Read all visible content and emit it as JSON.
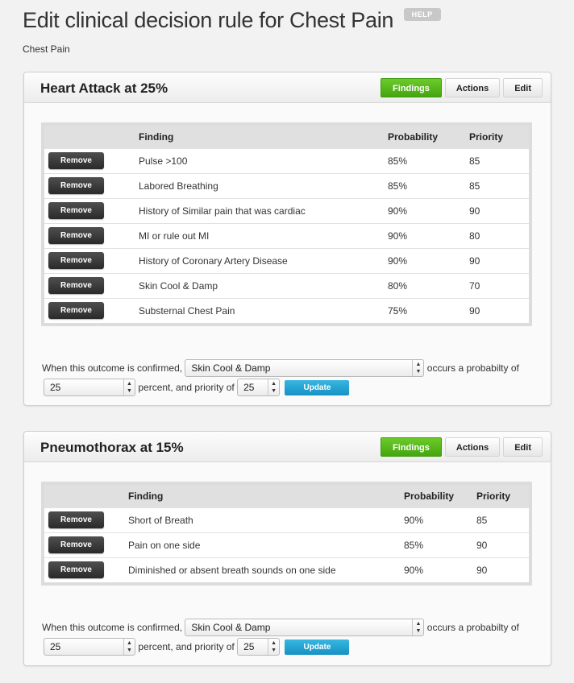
{
  "page": {
    "title": "Edit clinical decision rule for Chest Pain",
    "help_label": "HELP",
    "subtitle": "Chest Pain"
  },
  "tabs": {
    "findings": "Findings",
    "actions": "Actions",
    "edit": "Edit"
  },
  "columns": {
    "finding": "Finding",
    "probability": "Probability",
    "priority": "Priority"
  },
  "remove_label": "Remove",
  "form": {
    "text_confirmed": "When this outcome is confirmed,",
    "text_occurs": "occurs a probabilty of",
    "text_percent": "percent, and priority of",
    "update_label": "Update"
  },
  "colors": {
    "findings_tab": "#56b81a",
    "update_button": "#1fa3d3",
    "remove_button": "#333333"
  },
  "outcomes": [
    {
      "title": "Heart Attack at 25%",
      "rows": [
        {
          "finding": "Pulse >100",
          "probability": "85%",
          "priority": "85"
        },
        {
          "finding": "Labored Breathing",
          "probability": "85%",
          "priority": "85"
        },
        {
          "finding": "History of Similar pain that was cardiac",
          "probability": "90%",
          "priority": "90"
        },
        {
          "finding": "MI or rule out MI",
          "probability": "90%",
          "priority": "80"
        },
        {
          "finding": "History of Coronary Artery Disease",
          "probability": "90%",
          "priority": "90"
        },
        {
          "finding": "Skin Cool & Damp",
          "probability": "80%",
          "priority": "70"
        },
        {
          "finding": "Substernal Chest Pain",
          "probability": "75%",
          "priority": "90"
        }
      ],
      "selected_finding": "Skin Cool & Damp",
      "probability_value": "25",
      "priority_value": "25"
    },
    {
      "title": "Pneumothorax at 15%",
      "rows": [
        {
          "finding": "Short of Breath",
          "probability": "90%",
          "priority": "85"
        },
        {
          "finding": "Pain on one side",
          "probability": "85%",
          "priority": "90"
        },
        {
          "finding": "Diminished or absent breath sounds on one side",
          "probability": "90%",
          "priority": "90"
        }
      ],
      "selected_finding": "Skin Cool & Damp",
      "probability_value": "25",
      "priority_value": "25"
    }
  ]
}
